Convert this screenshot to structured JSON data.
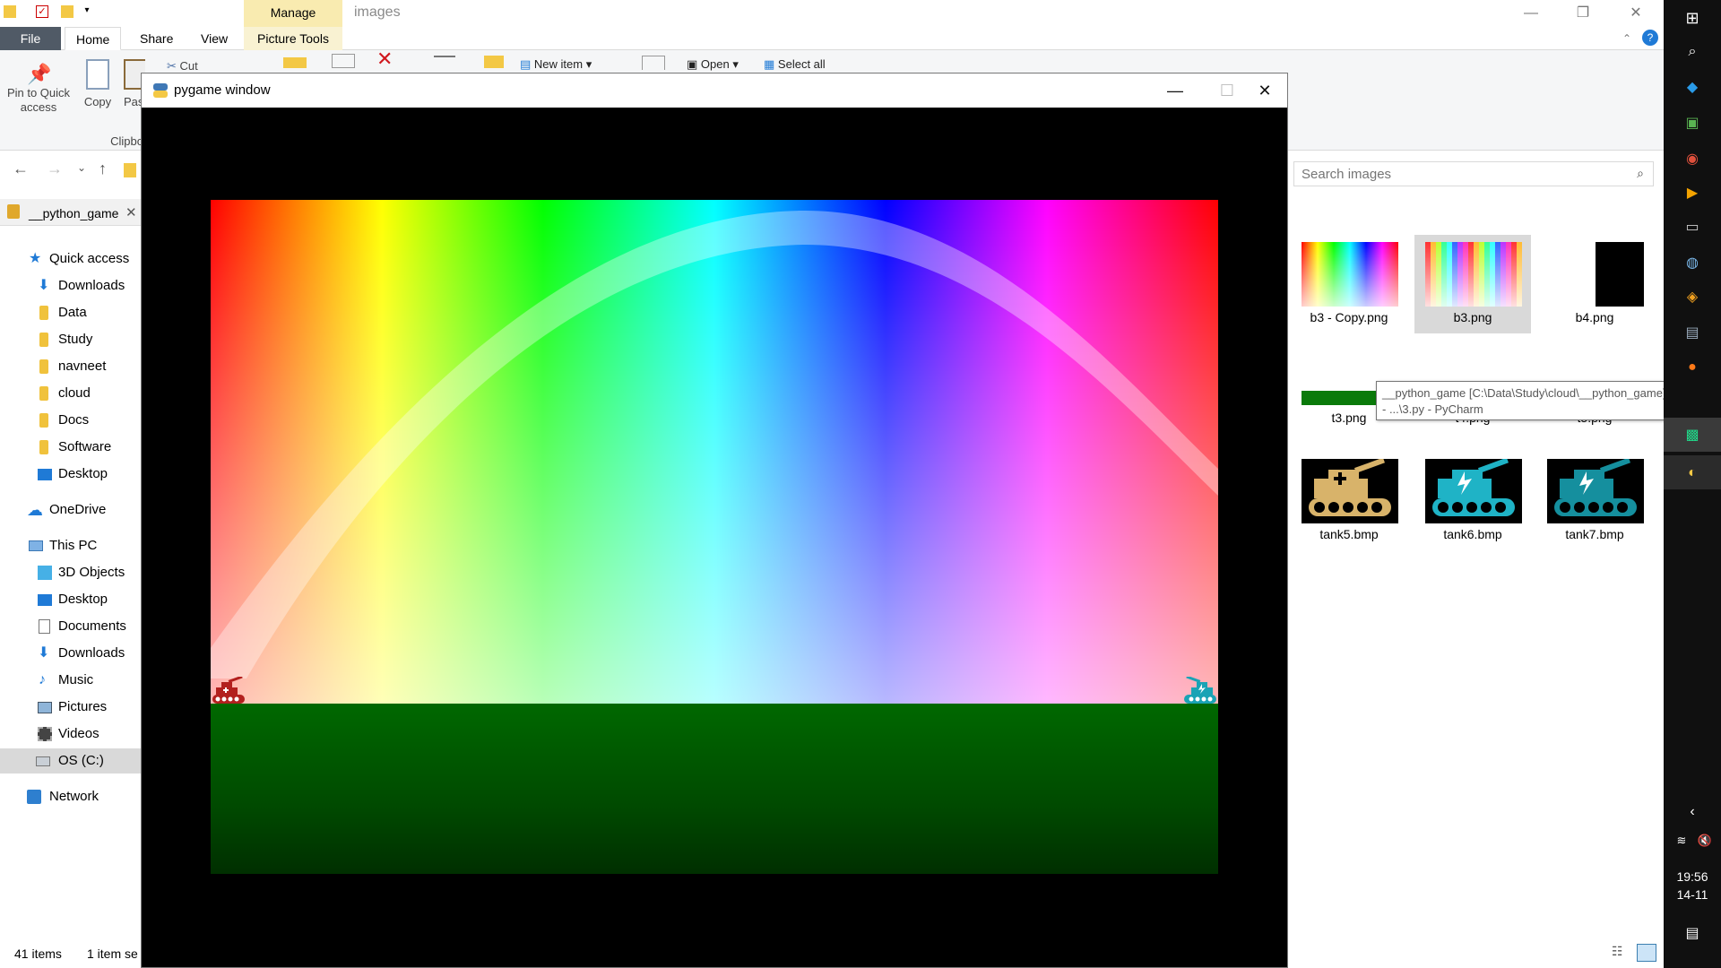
{
  "explorer": {
    "title": "images",
    "manage_tab": "Manage",
    "tabs": [
      "File",
      "Home",
      "Share",
      "View",
      "Picture Tools"
    ],
    "ribbon": {
      "pin": "Pin to Quick access",
      "copy": "Copy",
      "paste": "Pas",
      "cut": "Cut",
      "clipboard_group": "Clipbo",
      "new_item": "New item",
      "open": "Open",
      "select_all": "Select all"
    },
    "search_placeholder": "Search images",
    "python_tab": "__python_game",
    "nav": [
      {
        "label": "Quick access",
        "icon": "star-icon"
      },
      {
        "label": "Downloads",
        "icon": "downloads-icon"
      },
      {
        "label": "Data",
        "icon": "folder-icon"
      },
      {
        "label": "Study",
        "icon": "folder-icon"
      },
      {
        "label": "navneet",
        "icon": "folder-icon"
      },
      {
        "label": "cloud",
        "icon": "folder-icon"
      },
      {
        "label": "Docs",
        "icon": "folder-icon"
      },
      {
        "label": "Software",
        "icon": "folder-icon"
      },
      {
        "label": "Desktop",
        "icon": "desktop-icon"
      },
      {
        "label": "OneDrive",
        "icon": "cloud-icon"
      },
      {
        "label": "This PC",
        "icon": "pc-icon"
      },
      {
        "label": "3D Objects",
        "icon": "cube-icon"
      },
      {
        "label": "Desktop",
        "icon": "desktop-icon"
      },
      {
        "label": "Documents",
        "icon": "documents-icon"
      },
      {
        "label": "Downloads",
        "icon": "downloads-icon"
      },
      {
        "label": "Music",
        "icon": "music-icon"
      },
      {
        "label": "Pictures",
        "icon": "pictures-icon"
      },
      {
        "label": "Videos",
        "icon": "videos-icon"
      },
      {
        "label": "OS (C:)",
        "icon": "drive-icon"
      },
      {
        "label": "Network",
        "icon": "network-icon"
      }
    ],
    "status": {
      "items": "41 items",
      "selected": "1 item se"
    },
    "files": [
      {
        "name": "b3 - Copy.png"
      },
      {
        "name": "b3.png"
      },
      {
        "name": "b4.png"
      },
      {
        "name": "t3.png"
      },
      {
        "name": "t4.png"
      },
      {
        "name": "t5.png"
      },
      {
        "name": "tank5.bmp"
      },
      {
        "name": "tank6.bmp"
      },
      {
        "name": "tank7.bmp"
      }
    ],
    "tooltip": {
      "line1": "__python_game [C:\\Data\\Study\\cloud\\__python_game]",
      "line2": "- ...\\3.py - PyCharm"
    }
  },
  "pygame": {
    "title": "pygame window"
  },
  "taskbar": {
    "time": "19:56",
    "date": "14-11"
  },
  "colors": {
    "manage_tab_bg": "#f9ebb0",
    "file_tab_bg": "#505a66",
    "ground": "#006800",
    "tank_left": "#b2201e",
    "tank_right": "#1aa3b5"
  }
}
